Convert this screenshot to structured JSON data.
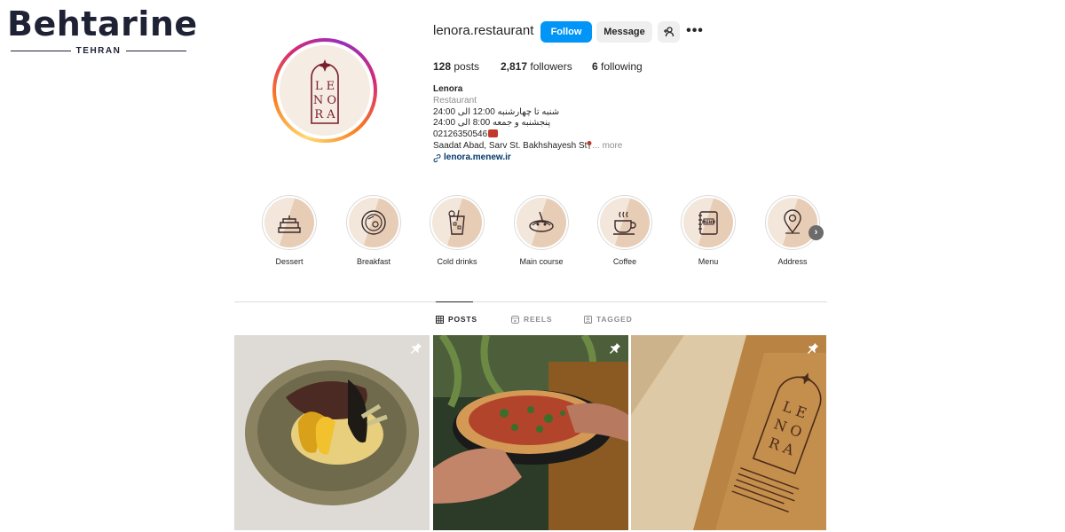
{
  "watermark": {
    "brand": "Behtarine",
    "city": "TEHRAN"
  },
  "profile": {
    "username": "lenora.restaurant",
    "follow_label": "Follow",
    "message_label": "Message",
    "avatar_text": "LENORA",
    "stats": {
      "posts_count": "128",
      "posts_label": "posts",
      "followers_count": "2,817",
      "followers_label": "followers",
      "following_count": "6",
      "following_label": "following"
    },
    "bio": {
      "name": "Lenora",
      "category": "Restaurant",
      "line1": "شنبه تا چهارشنبه 12:00 الی 24:00",
      "line2": "پنجشنبه و جمعه 8:00 الی 24:00",
      "phone": "02126350546",
      "address": "Saadat Abad, Sarv St. Bakhshayesh St",
      "more": "... more",
      "link": "lenora.menew.ir"
    }
  },
  "highlights": [
    {
      "label": "Dessert",
      "icon": "cake-icon"
    },
    {
      "label": "Breakfast",
      "icon": "breakfast-plate-icon"
    },
    {
      "label": "Cold drinks",
      "icon": "cold-drink-icon"
    },
    {
      "label": "Main course",
      "icon": "main-course-icon"
    },
    {
      "label": "Coffee",
      "icon": "coffee-cup-icon"
    },
    {
      "label": "Menu",
      "icon": "menu-book-icon"
    },
    {
      "label": "Address",
      "icon": "map-pin-icon"
    }
  ],
  "tabs": {
    "posts": "POSTS",
    "reels": "REELS",
    "tagged": "TAGGED",
    "active": "posts"
  },
  "posts": [
    {
      "subject": "steak-plate-photo",
      "pinned": true
    },
    {
      "subject": "pizza-photo",
      "pinned": true
    },
    {
      "subject": "menu-paper-photo",
      "pinned": true
    }
  ],
  "colors": {
    "follow_button": "#0095f6",
    "brand_maroon": "#7a1f2b",
    "highlight_bg": "#f3e6da"
  }
}
